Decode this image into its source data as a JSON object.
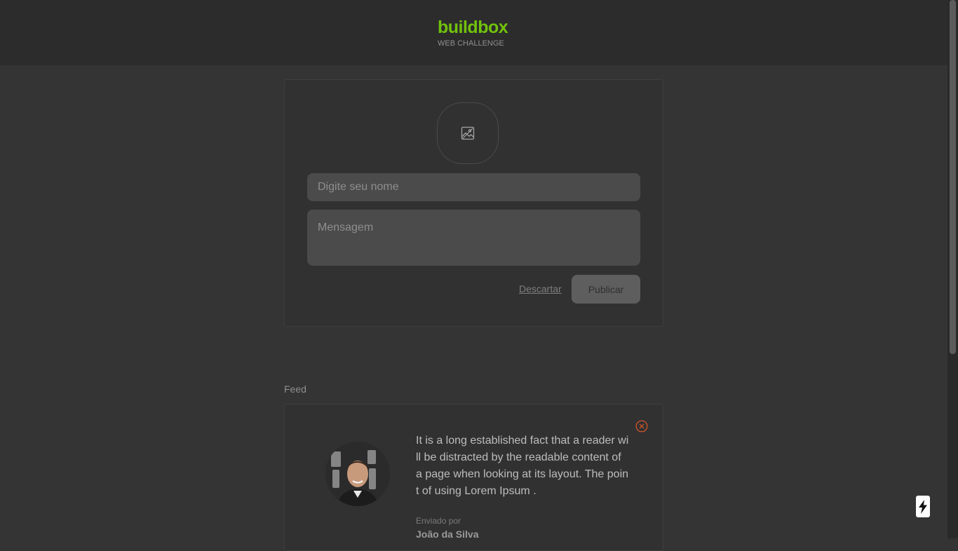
{
  "header": {
    "brand_name": "buildbox",
    "brand_subtitle": "WEB CHALLENGE"
  },
  "composer": {
    "photo_icon": "image-icon",
    "name_placeholder": "Digite seu nome",
    "name_value": "",
    "message_placeholder": "Mensagem",
    "message_value": "",
    "discard_label": "Descartar",
    "publish_label": "Publicar"
  },
  "feed": {
    "title": "Feed",
    "posts": [
      {
        "text": "It is a long established fact that a reader will be distracted by the readable content of a page when looking at its layout. The point of using Lorem Ipsum .",
        "sent_by_label": "Enviado por",
        "author": "João da Silva",
        "delete_icon": "close-circle-icon"
      }
    ]
  },
  "colors": {
    "brand": "#71c20c",
    "background": "#343434",
    "header": "#2c2c2c",
    "delete": "#e2582a"
  },
  "floating": {
    "icon": "bolt-icon"
  }
}
